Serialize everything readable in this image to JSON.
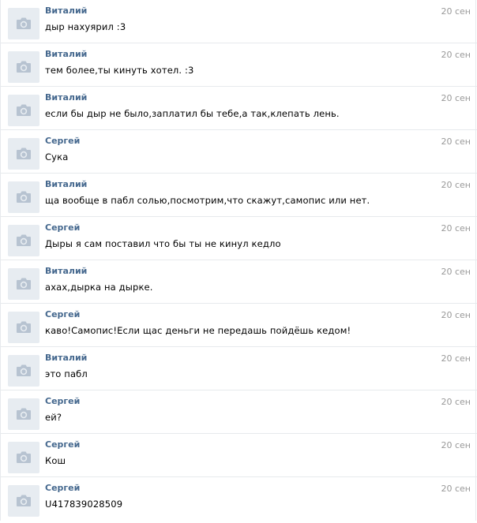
{
  "messages": [
    {
      "author": "Виталий",
      "date": "20 сен",
      "text": "дыр нахуярил :3"
    },
    {
      "author": "Виталий",
      "date": "20 сен",
      "text": "тем более,ты кинуть хотел. :3"
    },
    {
      "author": "Виталий",
      "date": "20 сен",
      "text": "если бы дыр не было,заплатил бы тебе,а так,клепать лень."
    },
    {
      "author": "Сергей",
      "date": "20 сен",
      "text": "Сука"
    },
    {
      "author": "Виталий",
      "date": "20 сен",
      "text": "ща вообще в пабл солью,посмотрим,что скажут,самопис или нет."
    },
    {
      "author": "Сергей",
      "date": "20 сен",
      "text": "Дыры я сам поставил что бы ты не кинул кедло"
    },
    {
      "author": "Виталий",
      "date": "20 сен",
      "text": "ахах,дырка на дырке."
    },
    {
      "author": "Сергей",
      "date": "20 сен",
      "text": "каво!Самопис!Если щас деньги не передашь пойдёшь кедом!"
    },
    {
      "author": "Виталий",
      "date": "20 сен",
      "text": "это пабл"
    },
    {
      "author": "Сергей",
      "date": "20 сен",
      "text": "ей?"
    },
    {
      "author": "Сергей",
      "date": "20 сен",
      "text": "Кош"
    },
    {
      "author": "Сергей",
      "date": "20 сен",
      "text": "U417839028509"
    }
  ],
  "avatar_icon": "camera-icon",
  "colors": {
    "author": "#45688e",
    "date": "#999999",
    "avatar_bg": "#e7ecf1",
    "icon": "#b7c3d1",
    "divider": "#e7eaed"
  }
}
